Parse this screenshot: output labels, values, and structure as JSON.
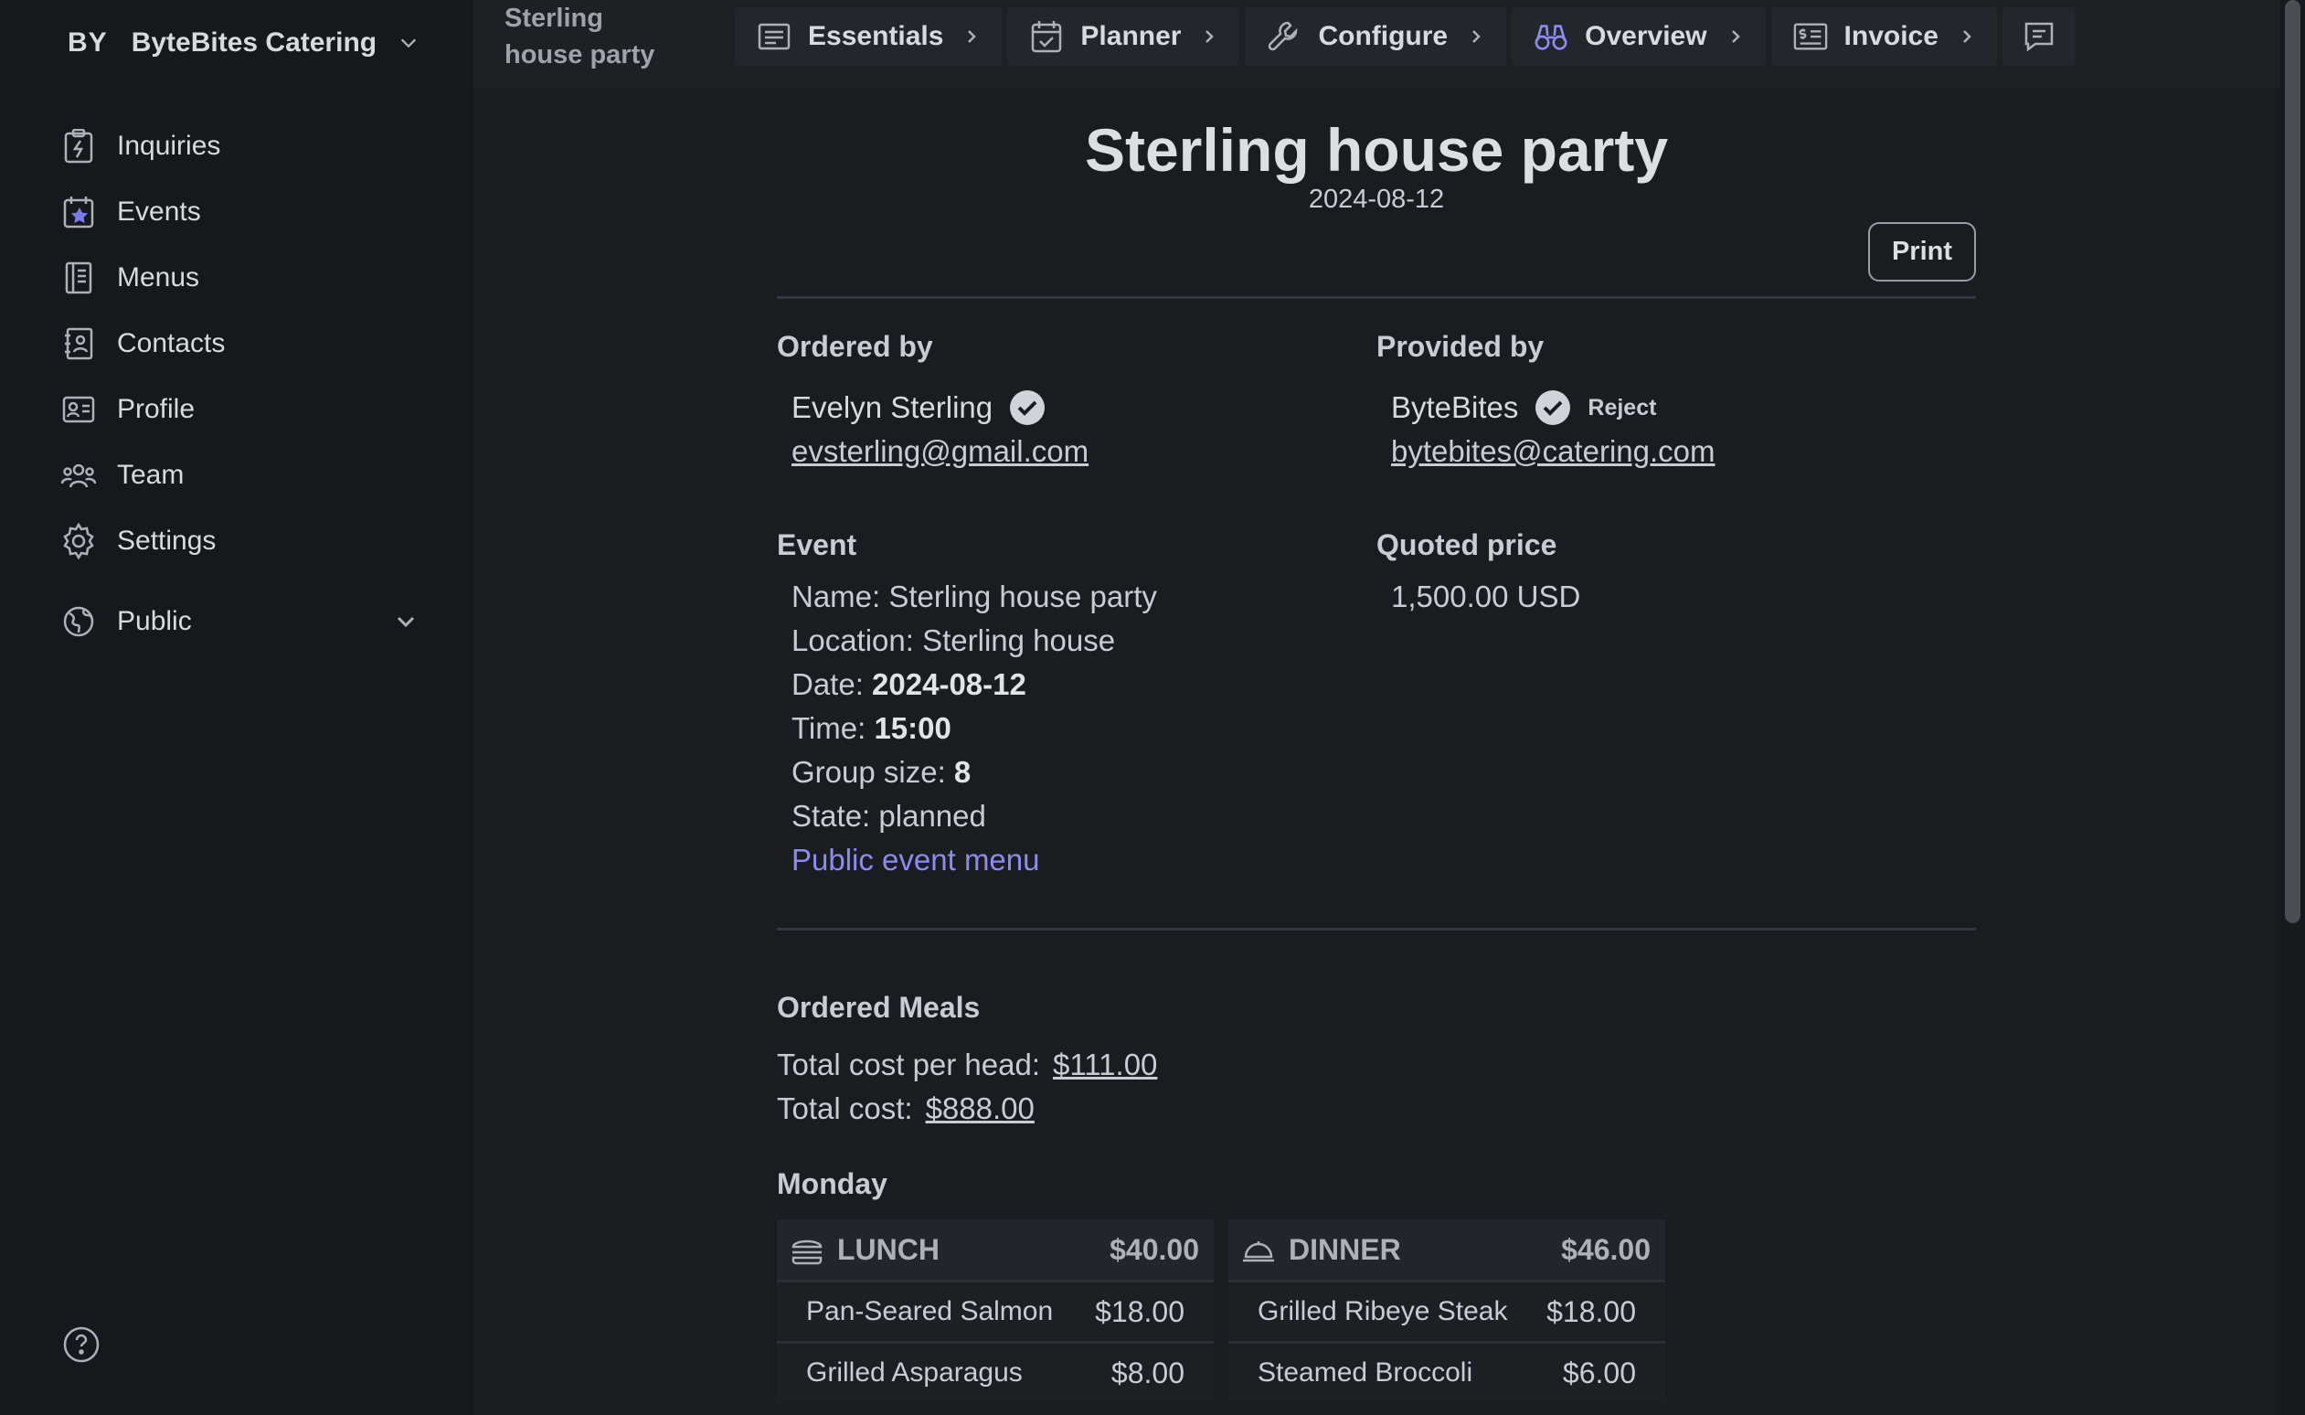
{
  "sidebar": {
    "org_abbr": "BY",
    "org_name": "ByteBites Catering",
    "items": [
      {
        "label": "Inquiries",
        "icon": "clipboard-icon"
      },
      {
        "label": "Events",
        "icon": "calendar-star-icon"
      },
      {
        "label": "Menus",
        "icon": "book-icon"
      },
      {
        "label": "Contacts",
        "icon": "contacts-icon"
      },
      {
        "label": "Profile",
        "icon": "id-card-icon"
      },
      {
        "label": "Team",
        "icon": "team-icon"
      },
      {
        "label": "Settings",
        "icon": "gear-icon"
      }
    ],
    "public_label": "Public"
  },
  "topbar": {
    "breadcrumb": "Sterling house party",
    "tabs": [
      {
        "label": "Essentials",
        "icon": "form-icon"
      },
      {
        "label": "Planner",
        "icon": "calendar-check-icon"
      },
      {
        "label": "Configure",
        "icon": "wrench-icon"
      },
      {
        "label": "Overview",
        "icon": "binoculars-icon"
      },
      {
        "label": "Invoice",
        "icon": "invoice-icon"
      }
    ],
    "chat_icon": "chat-icon"
  },
  "event": {
    "title": "Sterling house party",
    "date": "2024-08-12",
    "print_label": "Print",
    "ordered_by_label": "Ordered by",
    "orderer_name": "Evelyn Sterling",
    "orderer_email": "evsterling@gmail.com",
    "provided_by_label": "Provided by",
    "provider_name": "ByteBites",
    "provider_email": "bytebites@catering.com",
    "reject_label": "Reject",
    "event_label": "Event",
    "name_key": "Name:",
    "name_val": "Sterling house party",
    "location_key": "Location:",
    "location_val": "Sterling house",
    "date_key": "Date:",
    "date_val": "2024-08-12",
    "time_key": "Time:",
    "time_val": "15:00",
    "group_key": "Group size:",
    "group_val": "8",
    "state_key": "State:",
    "state_val": "planned",
    "public_menu_link": "Public event menu",
    "quoted_label": "Quoted price",
    "quoted_val": "1,500.00 USD"
  },
  "meals": {
    "title": "Ordered Meals",
    "per_head_key": "Total cost per head:",
    "per_head_val": "$111.00",
    "total_key": "Total cost:",
    "total_val": "$888.00",
    "day": "Monday",
    "lunch": {
      "label": "LUNCH",
      "price": "$40.00",
      "items": [
        {
          "name": "Pan-Seared Salmon",
          "price": "$18.00"
        },
        {
          "name": "Grilled Asparagus",
          "price": "$8.00"
        }
      ]
    },
    "dinner": {
      "label": "DINNER",
      "price": "$46.00",
      "items": [
        {
          "name": "Grilled Ribeye Steak",
          "price": "$18.00"
        },
        {
          "name": "Steamed Broccoli",
          "price": "$6.00"
        }
      ]
    }
  }
}
